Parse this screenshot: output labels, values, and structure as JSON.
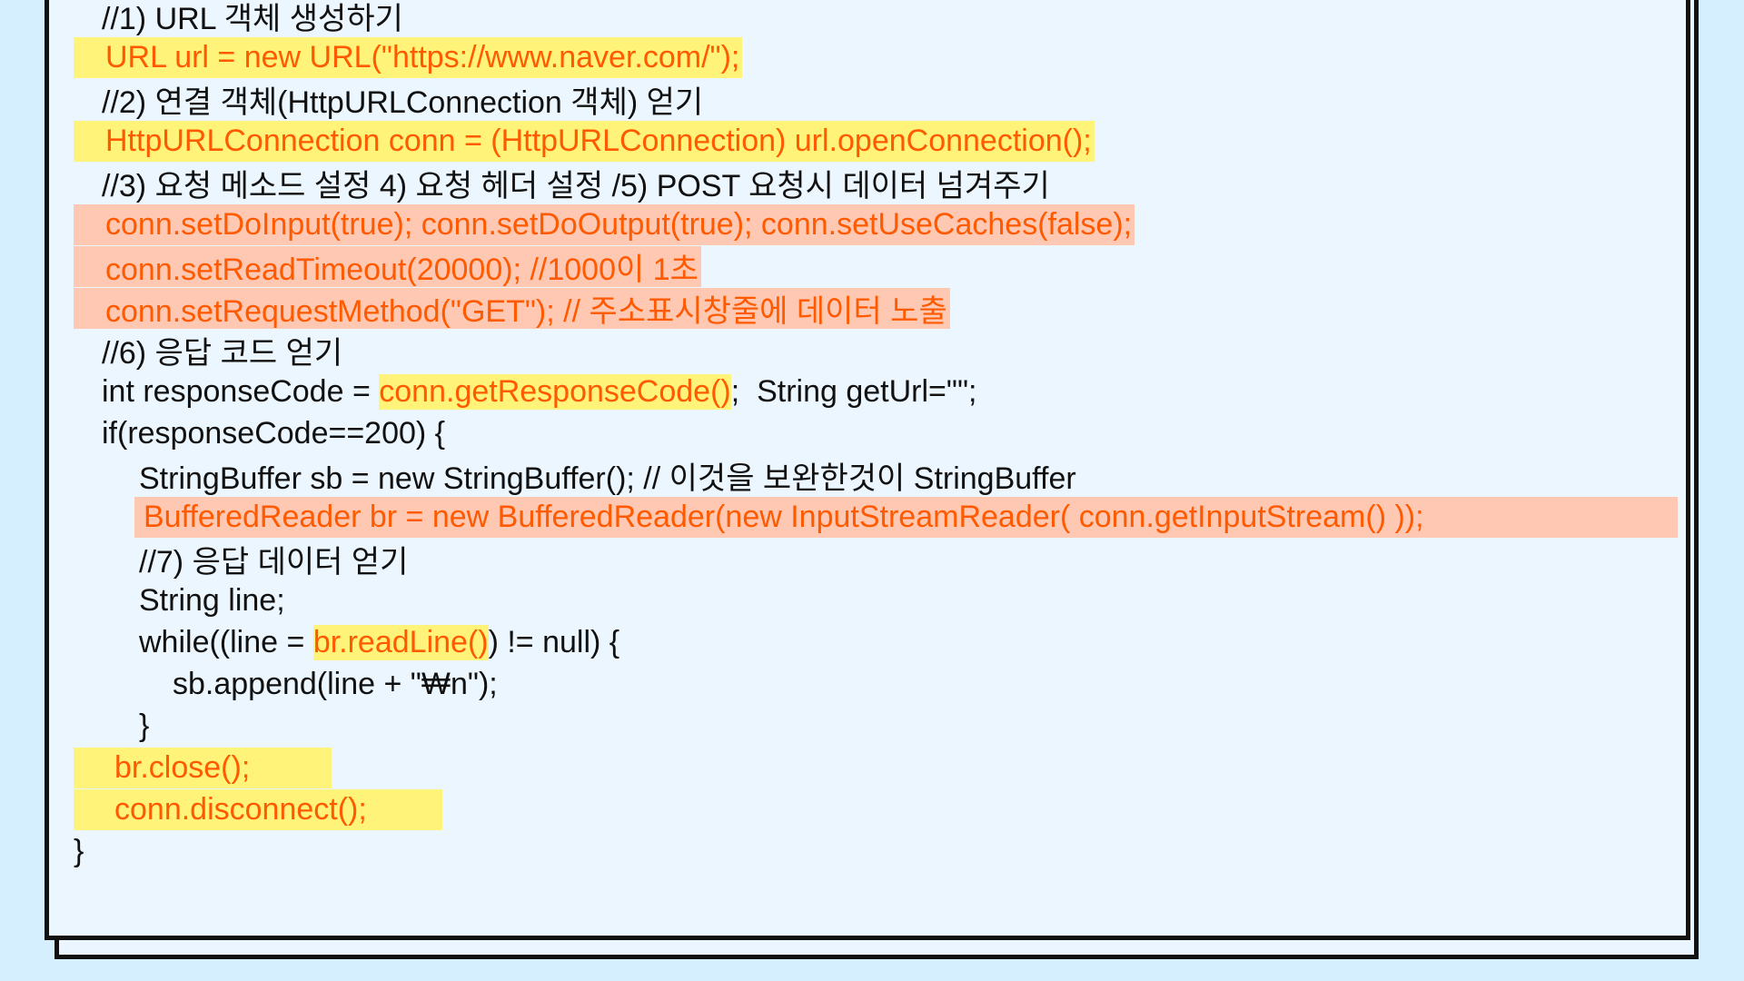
{
  "code_lines": [
    {
      "text": "//1) URL 객체 생성하기"
    },
    {
      "text": "URL url = new URL(\"https://www.naver.com/\");"
    },
    {
      "text": "//2) 연결 객체(HttpURLConnection 객체) 얻기"
    },
    {
      "text": "HttpURLConnection conn = (HttpURLConnection) url.openConnection();"
    },
    {
      "text": "//3) 요청 메소드 설정 4) 요청 헤더 설정 /5) POST 요청시 데이터 넘겨주기"
    },
    {
      "text": "conn.setDoInput(true); conn.setDoOutput(true); conn.setUseCaches(false);"
    },
    {
      "text": "conn.setReadTimeout(20000); //1000이 1초"
    },
    {
      "text": "conn.setRequestMethod(\"GET\"); // 주소표시창줄에 데이터 노출"
    },
    {
      "text": "//6) 응답 코드 얻기"
    },
    {
      "prefix": "int responseCode = ",
      "highlight": "conn.getResponseCode()",
      "suffix": ";  String getUrl=\"\";"
    },
    {
      "text": "if(responseCode==200) {"
    },
    {
      "text": "StringBuffer sb = new StringBuffer(); // 이것을 보완한것이 StringBuffer"
    },
    {
      "text": "BufferedReader br = new BufferedReader(new InputStreamReader( conn.getInputStream() ));"
    },
    {
      "text": "//7) 응답 데이터 얻기"
    },
    {
      "text": "String line;"
    },
    {
      "prefix": "while((line = ",
      "highlight": "br.readLine()",
      "suffix": ") != null) {"
    },
    {
      "text": "sb.append(line + \"₩n\");"
    },
    {
      "text": "}"
    },
    {
      "text": "br.close();"
    },
    {
      "text": "conn.disconnect();"
    },
    {
      "text": "}"
    }
  ],
  "colors": {
    "background": "#d6efff",
    "card": "#ebf6ff",
    "yellow_highlight": "#fff37a",
    "peach_highlight": "#ffc8b2",
    "orange_text": "#ff5a00",
    "black_text": "#111111"
  }
}
